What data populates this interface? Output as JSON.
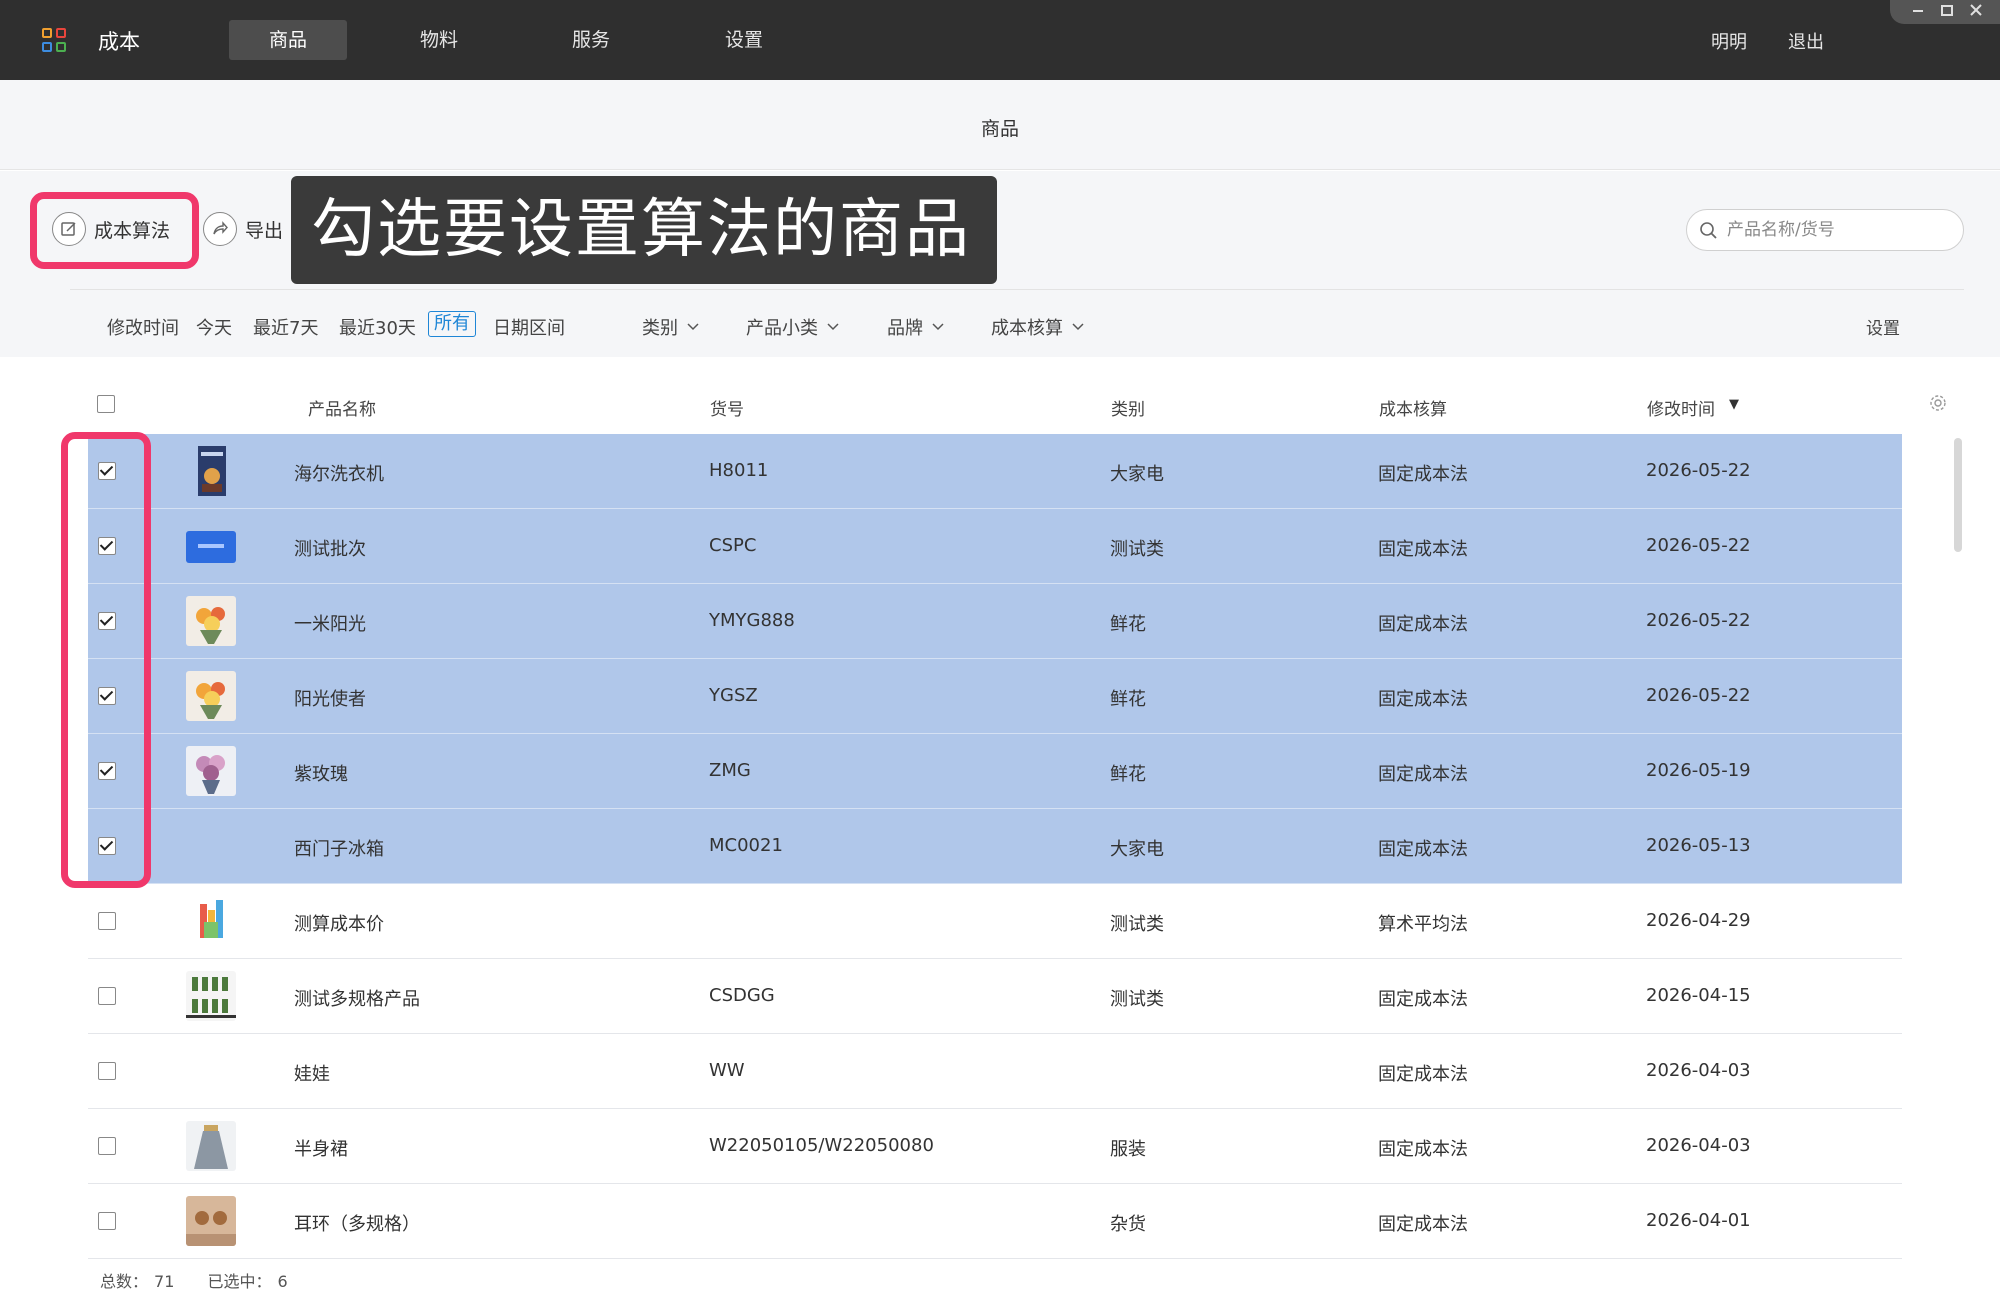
{
  "app": {
    "title": "成本",
    "nav": [
      {
        "label": "商品",
        "active": true
      },
      {
        "label": "物料",
        "active": false
      },
      {
        "label": "服务",
        "active": false
      },
      {
        "label": "设置",
        "active": false
      }
    ],
    "user": "明明",
    "logout": "退出",
    "window_controls": [
      "minimize-icon",
      "maximize-icon",
      "close-icon"
    ]
  },
  "page": {
    "title": "商品"
  },
  "toolbar": {
    "cost_algorithm_label": "成本算法",
    "export_label": "导出",
    "tip_banner": "勾选要设置算法的商品",
    "search_placeholder": "产品名称/货号"
  },
  "filters": {
    "modified_label": "修改时间",
    "time_options": [
      "今天",
      "最近7天",
      "最近30天",
      "所有",
      "日期区间"
    ],
    "selected_time": "所有",
    "dropdowns": [
      "类别",
      "产品小类",
      "品牌",
      "成本核算"
    ],
    "settings": "设置"
  },
  "table": {
    "columns": [
      "产品名称",
      "货号",
      "类别",
      "成本核算",
      "修改时间"
    ],
    "sort_indicator": "▼",
    "rows": [
      {
        "name": "海尔洗衣机",
        "sku": "H8011",
        "category": "大家电",
        "cost_method": "固定成本法",
        "modified": "2026-05-22",
        "checked": true,
        "thumb": "book-cover"
      },
      {
        "name": "测试批次",
        "sku": "CSPC",
        "category": "测试类",
        "cost_method": "固定成本法",
        "modified": "2026-05-22",
        "checked": true,
        "thumb": "blue-card"
      },
      {
        "name": "一米阳光",
        "sku": "YMYG888",
        "category": "鲜花",
        "cost_method": "固定成本法",
        "modified": "2026-05-22",
        "checked": true,
        "thumb": "flower-bouquet"
      },
      {
        "name": "阳光使者",
        "sku": "YGSZ",
        "category": "鲜花",
        "cost_method": "固定成本法",
        "modified": "2026-05-22",
        "checked": true,
        "thumb": "flower-bouquet"
      },
      {
        "name": "紫玫瑰",
        "sku": "ZMG",
        "category": "鲜花",
        "cost_method": "固定成本法",
        "modified": "2026-05-19",
        "checked": true,
        "thumb": "rose-bouquet"
      },
      {
        "name": "西门子冰箱",
        "sku": "MC0021",
        "category": "大家电",
        "cost_method": "固定成本法",
        "modified": "2026-05-13",
        "checked": true,
        "thumb": ""
      },
      {
        "name": "测算成本价",
        "sku": "",
        "category": "测试类",
        "cost_method": "算术平均法",
        "modified": "2026-04-29",
        "checked": false,
        "thumb": "colorful-items"
      },
      {
        "name": "测试多规格产品",
        "sku": "CSDGG",
        "category": "测试类",
        "cost_method": "固定成本法",
        "modified": "2026-04-15",
        "checked": false,
        "thumb": "bottles-grid"
      },
      {
        "name": "娃娃",
        "sku": "WW",
        "category": "",
        "cost_method": "固定成本法",
        "modified": "2026-04-03",
        "checked": false,
        "thumb": ""
      },
      {
        "name": "半身裙",
        "sku": "W22050105/W22050080",
        "category": "服装",
        "cost_method": "固定成本法",
        "modified": "2026-04-03",
        "checked": false,
        "thumb": "skirt"
      },
      {
        "name": "耳环（多规格）",
        "sku": "",
        "category": "杂货",
        "cost_method": "固定成本法",
        "modified": "2026-04-01",
        "checked": false,
        "thumb": "earrings"
      }
    ]
  },
  "footer": {
    "total_label": "总数：",
    "total_value": "71",
    "selected_label": "已选中：",
    "selected_value": "6"
  },
  "colors": {
    "topbar": "#2f2f2f",
    "selected_row": "#b0c7ea",
    "highlight": "#f0386b",
    "accent": "#1e86d6"
  }
}
